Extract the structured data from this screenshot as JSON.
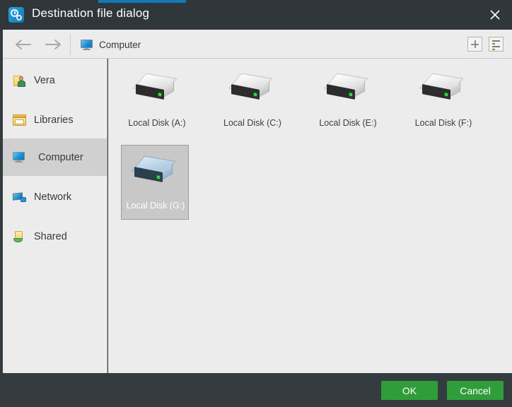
{
  "window": {
    "title": "Destination file dialog",
    "app_icon": "clock-gear-icon",
    "close_icon": "close-icon",
    "accent_color": "#1479b8",
    "titlebar_color": "#2f373a"
  },
  "toolbar": {
    "back_icon": "arrow-left-icon",
    "forward_icon": "arrow-right-icon",
    "breadcrumb": {
      "icon": "monitor-icon",
      "label": "Computer"
    },
    "new_folder_icon": "plus-icon",
    "view_mode_icon": "list-view-icon"
  },
  "sidebar": {
    "items": [
      {
        "label": "Vera",
        "icon": "user-folder-icon",
        "selected": false
      },
      {
        "label": "Libraries",
        "icon": "libraries-icon",
        "selected": false
      },
      {
        "label": "Computer",
        "icon": "monitor-icon",
        "selected": true
      },
      {
        "label": "Network",
        "icon": "network-icon",
        "selected": false
      },
      {
        "label": "Shared",
        "icon": "shared-folder-icon",
        "selected": false
      }
    ]
  },
  "content": {
    "drives": [
      {
        "label": "Local Disk (A:)",
        "icon": "hard-drive-icon",
        "selected": false
      },
      {
        "label": "Local Disk (C:)",
        "icon": "hard-drive-icon",
        "selected": false
      },
      {
        "label": "Local Disk (E:)",
        "icon": "hard-drive-icon",
        "selected": false
      },
      {
        "label": "Local Disk (F:)",
        "icon": "hard-drive-icon",
        "selected": false
      },
      {
        "label": "Local Disk (G:)",
        "icon": "hard-drive-icon",
        "selected": true
      }
    ]
  },
  "footer": {
    "ok_label": "OK",
    "cancel_label": "Cancel",
    "button_color": "#2f9e3a"
  }
}
